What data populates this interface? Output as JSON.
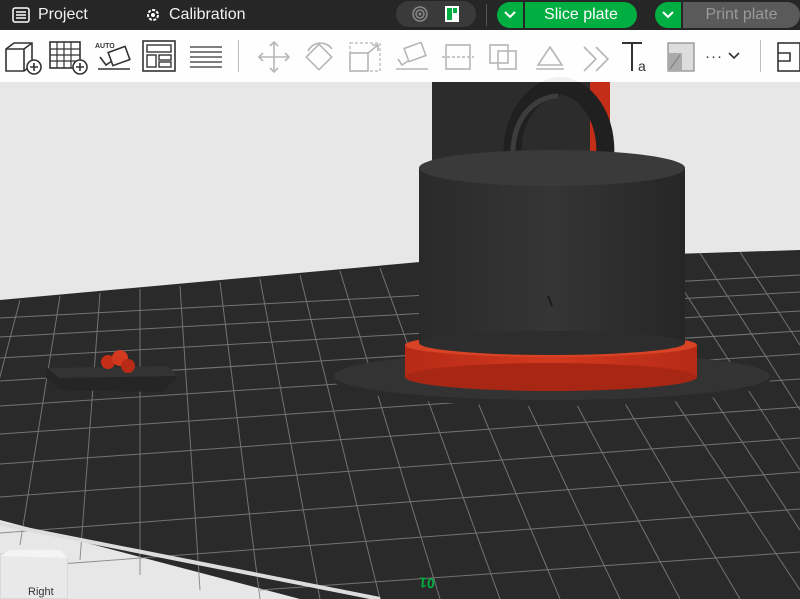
{
  "topbar": {
    "tabs": [
      {
        "label": "Project",
        "icon": "list-icon"
      },
      {
        "label": "Calibration",
        "icon": "gear-icon"
      }
    ],
    "slice_label": "Slice plate",
    "print_label": "Print plate",
    "accent": "#00ae42"
  },
  "toolbar": {
    "tools": [
      "add-object",
      "add-plate",
      "auto-orient",
      "arrange",
      "split-layers",
      "move",
      "rotate",
      "scale",
      "lay-on-face",
      "cut",
      "boolean",
      "paint",
      "support",
      "text",
      "measure"
    ],
    "more_label": "···"
  },
  "scene": {
    "plate_label": "01",
    "model_color": "#2b2b2b",
    "accent_color": "#c8331c"
  },
  "navcube": {
    "face_label": "Right"
  }
}
